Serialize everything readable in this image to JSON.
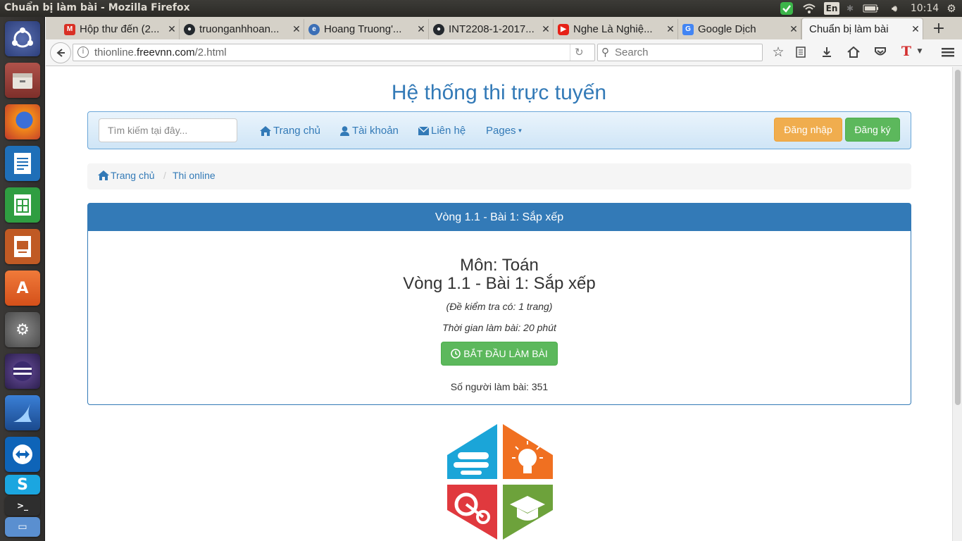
{
  "os": {
    "window_title": "Chuẩn bị làm bài - Mozilla Firefox",
    "keyboard_layout": "En",
    "clock": "10:14"
  },
  "tabs": [
    {
      "title": "Hộp thư đến (2...",
      "icon": "gmail-icon",
      "color": "#d93025"
    },
    {
      "title": "truonganhhoan...",
      "icon": "github-icon",
      "color": "#24292e"
    },
    {
      "title": "Hoang Truong'...",
      "icon": "blog-icon",
      "color": "#3b6fb6"
    },
    {
      "title": "INT2208-1-2017...",
      "icon": "github-icon",
      "color": "#24292e"
    },
    {
      "title": "Nghe Là Nghiệ...",
      "icon": "youtube-icon",
      "color": "#e62117"
    },
    {
      "title": "Google Dịch",
      "icon": "google-translate-icon",
      "color": "#4285f4"
    },
    {
      "title": "Chuẩn bị làm bài",
      "icon": "",
      "color": ""
    }
  ],
  "browser": {
    "url_prefix": "thionline.",
    "url_domain": "freevnn.com",
    "url_path": "/2.html",
    "search_placeholder": "Search"
  },
  "site": {
    "title": "Hệ thống thi trực tuyến",
    "search_placeholder": "Tìm kiếm tại đây...",
    "nav": {
      "home": "Trang chủ",
      "account": "Tài khoản",
      "contact": "Liên hệ",
      "pages": "Pages"
    },
    "login": "Đăng nhập",
    "register": "Đăng ký",
    "login_color": "#f0ad4e",
    "register_color": "#5cb85c",
    "brand_color": "#337ab7"
  },
  "breadcrumb": {
    "home": "Trang chủ",
    "current": "Thi online"
  },
  "exam": {
    "panel_title": "Vòng 1.1 - Bài 1: Sắp xếp",
    "subject": "Môn: Toán",
    "name": "Vòng 1.1 - Bài 1: Sắp xếp",
    "pages_note": "(Đề kiểm tra có: 1 trang)",
    "duration": "Thời gian làm bài: 20 phút",
    "start_button": "BẮT ĐẦU LÀM BÀI",
    "participants": "Số người làm bài: 351"
  }
}
